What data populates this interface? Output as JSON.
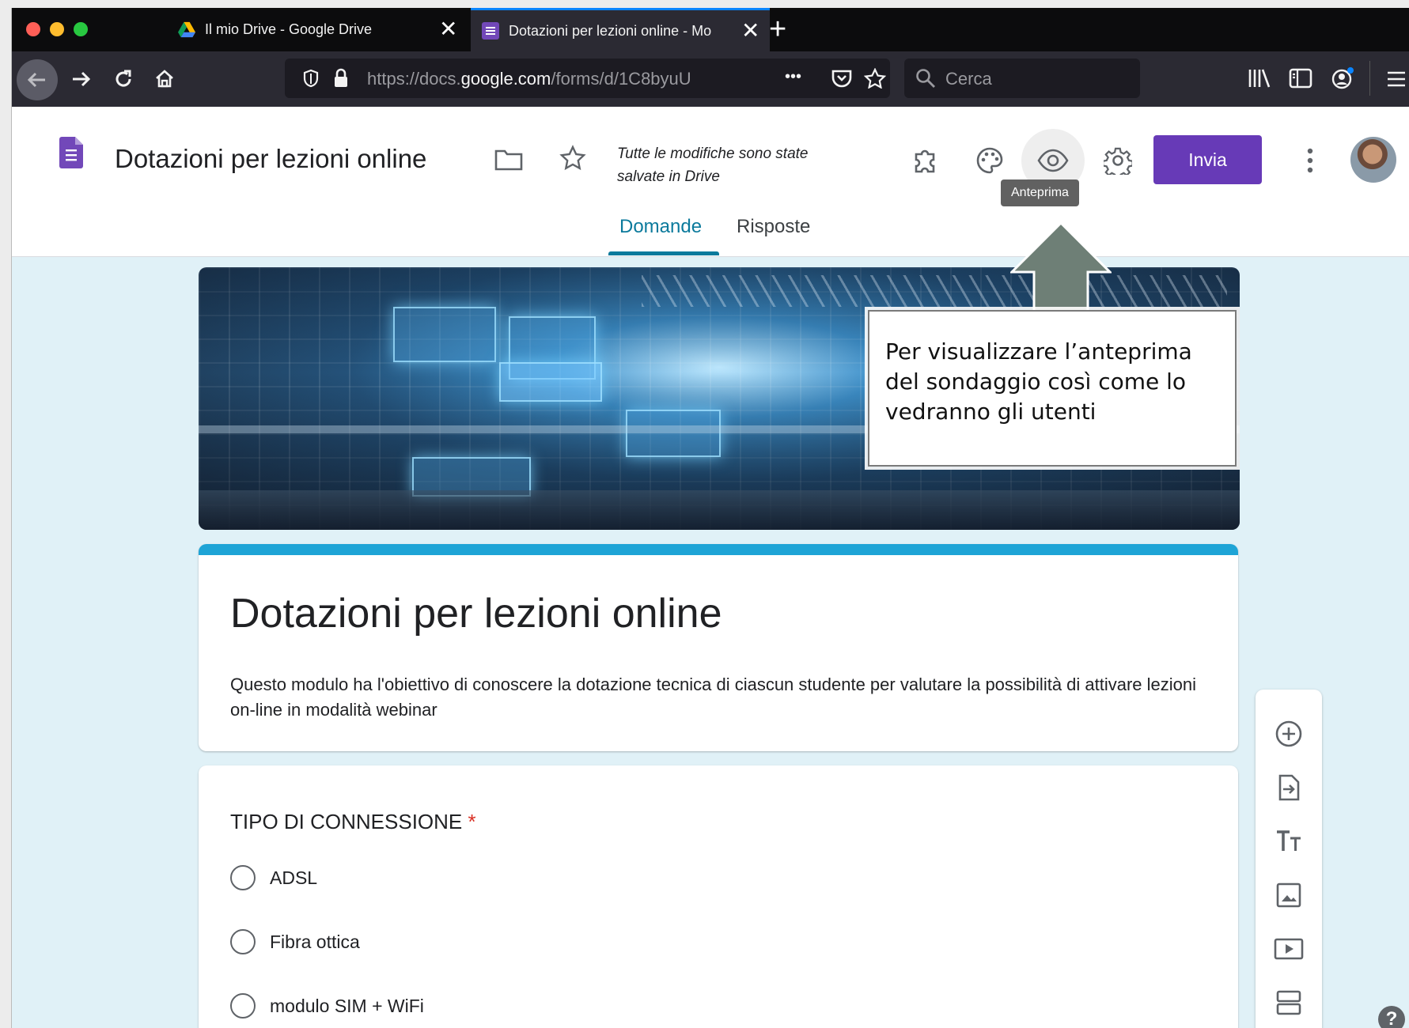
{
  "browser": {
    "tabs": [
      {
        "title": "Il mio Drive - Google Drive",
        "close": "✕"
      },
      {
        "title": "Dotazioni per lezioni online - Mo",
        "close": "✕"
      }
    ],
    "new_tab": "+",
    "url": {
      "prefix": "https://docs.",
      "domain": "google.com",
      "path": "/forms/d/1C8byuU"
    },
    "url_more": "•••",
    "search_placeholder": "Cerca"
  },
  "app": {
    "doc_title": "Dotazioni per lezioni online",
    "save_status": "Tutte le modifiche sono state salvate in Drive",
    "send_label": "Invia",
    "tooltip": "Anteprima",
    "tabs": [
      {
        "label": "Domande",
        "active": true
      },
      {
        "label": "Risposte",
        "active": false
      }
    ],
    "accent_color": "#673ab7",
    "theme_color": "#1ea4d6"
  },
  "callout": {
    "text": "Per visualizzare l’anteprima del sondaggio così come lo vedranno gli utenti"
  },
  "form": {
    "title": "Dotazioni per lezioni online",
    "description": "Questo modulo ha l'obiettivo di conoscere la dotazione tecnica di ciascun studente per valutare la possibilità di attivare lezioni on-line in modalità webinar",
    "question": {
      "title": "TIPO DI CONNESSIONE",
      "required_mark": "*",
      "options": [
        "ADSL",
        "Fibra ottica",
        "modulo SIM + WiFi"
      ]
    }
  },
  "toolbar_icons": [
    "add-question-icon",
    "import-questions-icon",
    "add-title-icon",
    "add-image-icon",
    "add-video-icon",
    "add-section-icon"
  ],
  "help": "?"
}
